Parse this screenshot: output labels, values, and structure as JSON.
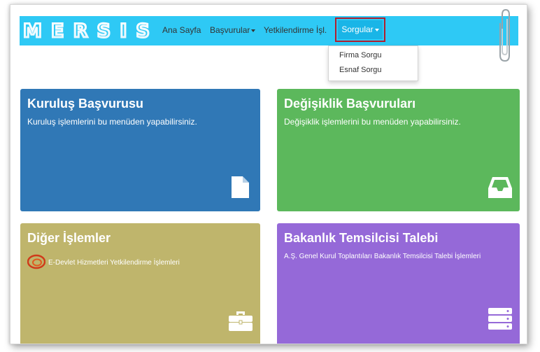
{
  "brand": {
    "logo_text": "MERSIS"
  },
  "nav": {
    "home": "Ana Sayfa",
    "applications": "Başvurular",
    "authorized": "Yetkilendirme İşl.",
    "queries": "Sorgular"
  },
  "dropdown": {
    "items": [
      "Firma Sorgu",
      "Esnaf Sorgu"
    ]
  },
  "cards": [
    {
      "title": "Kuruluş Başvurusu",
      "description": "Kuruluş işlemlerini bu menüden yapabilirsiniz.",
      "icon": "file-icon",
      "color": "#3078b6"
    },
    {
      "title": "Değişiklik Başvuruları",
      "description": "Değişiklik işlemlerini bu menüden yapabilirsiniz.",
      "icon": "inbox-icon",
      "color": "#5cb85c"
    },
    {
      "title": "Diğer İşlemler",
      "description": "E-Devlet Hizmetleri Yetkilendirme İşlemleri",
      "icon": "briefcase-icon",
      "color": "#bfb56c"
    },
    {
      "title": "Bakanlık Temsilcisi Talebi",
      "description": "A.Ş. Genel Kurul Toplantıları Bakanlık Temsilcisi Talebi İşlemleri",
      "icon": "server-icon",
      "color": "#9569d8"
    }
  ],
  "colors": {
    "navbar": "#2ec9f5",
    "active_nav": "#19b5e7",
    "highlight_border": "#b01e2e"
  }
}
